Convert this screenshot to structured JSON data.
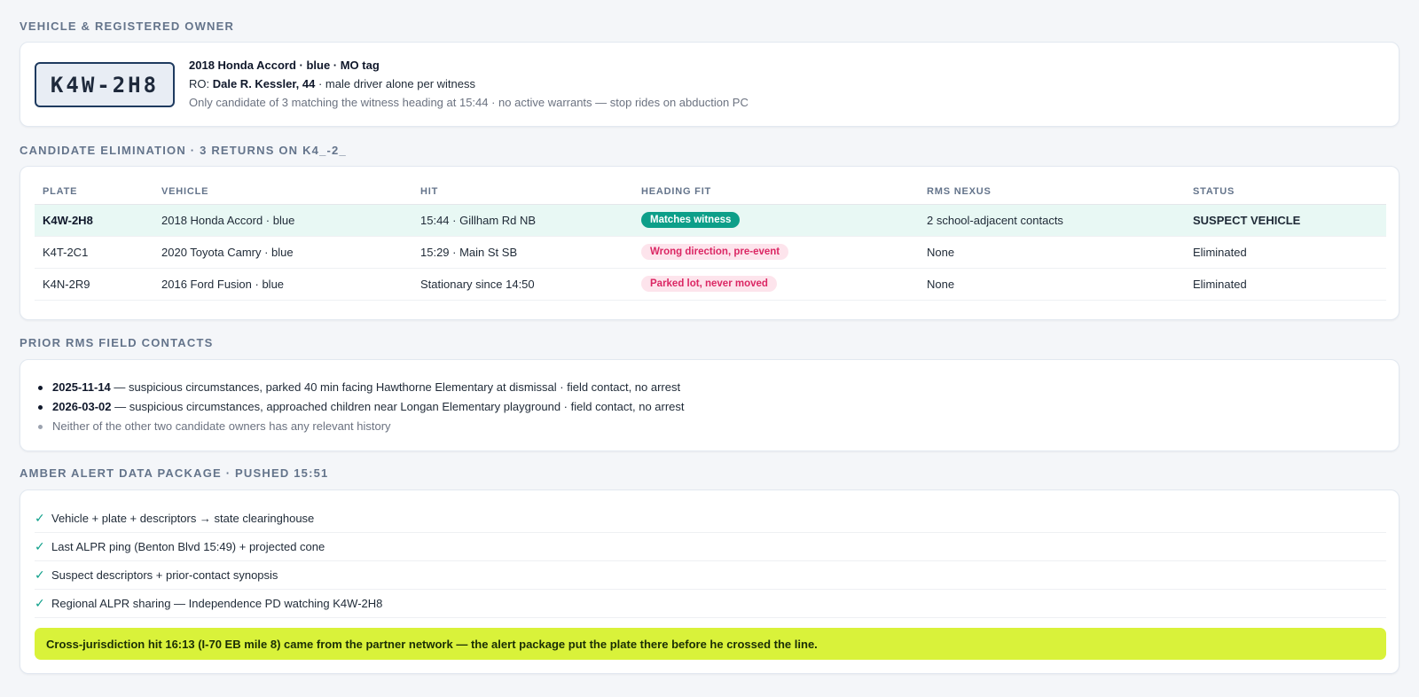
{
  "sections": {
    "vehicle": "VEHICLE & REGISTERED OWNER",
    "candidates": "CANDIDATE ELIMINATION · 3 RETURNS ON K4_-2_",
    "contacts": "PRIOR RMS FIELD CONTACTS",
    "amber": "AMBER ALERT DATA PACKAGE · PUSHED 15:51"
  },
  "vehicle": {
    "plate": "K4W-2H8",
    "title": "2018 Honda Accord · blue · MO tag",
    "ro_prefix": "RO: ",
    "ro_name": "Dale R. Kessler, 44",
    "ro_suffix": " · male driver alone per witness",
    "note": "Only candidate of 3 matching the witness heading at 15:44 · no active warrants — stop rides on abduction PC"
  },
  "candidates": {
    "headers": [
      "PLATE",
      "VEHICLE",
      "HIT",
      "HEADING FIT",
      "RMS NEXUS",
      "STATUS"
    ],
    "rows": [
      {
        "plate": "K4W-2H8",
        "vehicle": "2018 Honda Accord · blue",
        "hit": "15:44 · Gillham Rd NB",
        "fit": "Matches witness",
        "nexus": "2 school-adjacent contacts",
        "status": "SUSPECT VEHICLE"
      },
      {
        "plate": "K4T-2C1",
        "vehicle": "2020 Toyota Camry · blue",
        "hit": "15:29 · Main St SB",
        "fit": "Wrong direction, pre-event",
        "nexus": "None",
        "status": "Eliminated"
      },
      {
        "plate": "K4N-2R9",
        "vehicle": "2016 Ford Fusion · blue",
        "hit": "Stationary since 14:50",
        "fit": "Parked lot, never moved",
        "nexus": "None",
        "status": "Eliminated"
      }
    ]
  },
  "contacts": {
    "items": [
      {
        "date": "2025-11-14",
        "text": " — suspicious circumstances, parked 40 min facing Hawthorne Elementary at dismissal · field contact, no arrest"
      },
      {
        "date": "2026-03-02",
        "text": " — suspicious circumstances, approached children near Longan Elementary playground · field contact, no arrest"
      }
    ],
    "note": "Neither of the other two candidate owners has any relevant history"
  },
  "amber": {
    "check_glyph": "✓",
    "items": [
      "Vehicle + plate + descriptors → state clearinghouse",
      "Last ALPR ping (Benton Blvd 15:49) + projected cone",
      "Suspect descriptors + prior-contact synopsis",
      "Regional ALPR sharing — Independence PD watching K4W-2H8"
    ],
    "banner": "Cross-jurisdiction hit 16:13 (I-70 EB mile 8) came from the partner network — the alert package put the plate there before he crossed the line."
  },
  "colors": {
    "accent": "#0d9f89",
    "bad_pill_bg": "#fde4ec",
    "bad_pill_text": "#db2764",
    "banner": "#d9f23a"
  }
}
